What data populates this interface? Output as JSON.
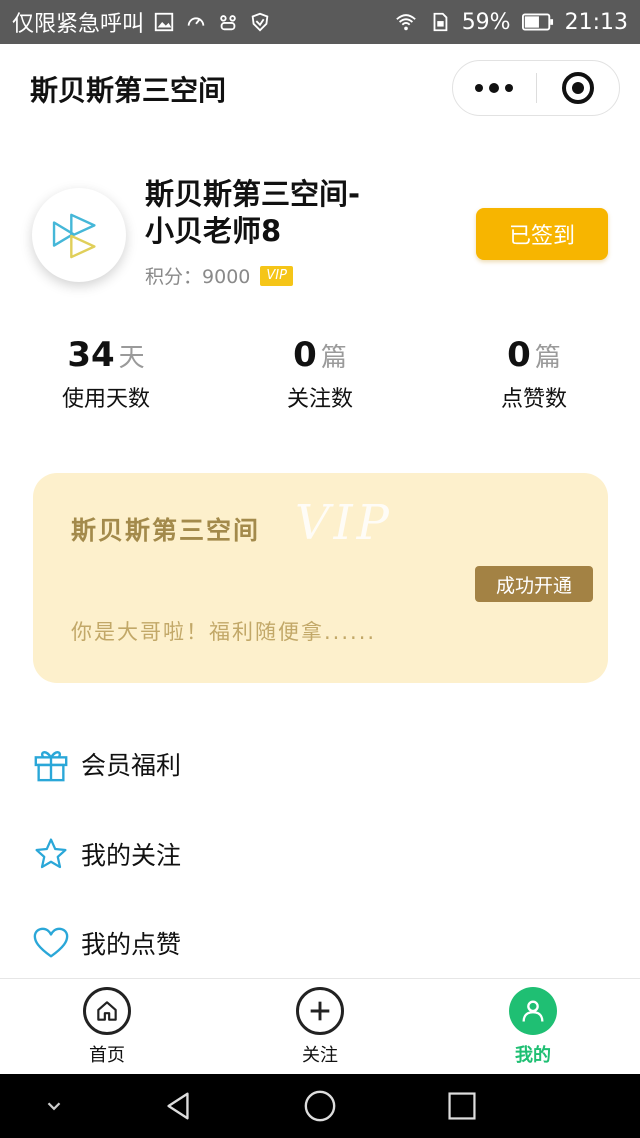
{
  "status_bar": {
    "carrier": "仅限紧急呼叫",
    "battery": "59%",
    "time": "21:13"
  },
  "header": {
    "title": "斯贝斯第三空间"
  },
  "profile": {
    "name": "斯贝斯第三空间-小贝老师8",
    "points_label": "积分：",
    "points_value": "9000",
    "vip_badge": "VIP",
    "checkin_label": "已签到"
  },
  "stats": [
    {
      "value": "34",
      "unit": "天",
      "label": "使用天数"
    },
    {
      "value": "0",
      "unit": "篇",
      "label": "关注数"
    },
    {
      "value": "0",
      "unit": "篇",
      "label": "点赞数"
    }
  ],
  "vip_card": {
    "title": "斯贝斯第三空间",
    "watermark": "VIP",
    "status_button": "成功开通",
    "slogan": "你是大哥啦！福利随便拿......"
  },
  "menu": [
    {
      "label": "会员福利",
      "icon": "gift-icon"
    },
    {
      "label": "我的关注",
      "icon": "star-icon"
    },
    {
      "label": "我的点赞",
      "icon": "heart-icon"
    }
  ],
  "tabs": [
    {
      "label": "首页",
      "icon": "home-icon",
      "active": false
    },
    {
      "label": "关注",
      "icon": "plus-icon",
      "active": false
    },
    {
      "label": "我的",
      "icon": "user-icon",
      "active": true
    }
  ],
  "colors": {
    "accent_green": "#1fbf73",
    "checkin_yellow": "#f7b500",
    "vip_card_bg": "#fdf0cc",
    "vip_gold": "#a38244",
    "icon_blue": "#2aa7d8"
  }
}
